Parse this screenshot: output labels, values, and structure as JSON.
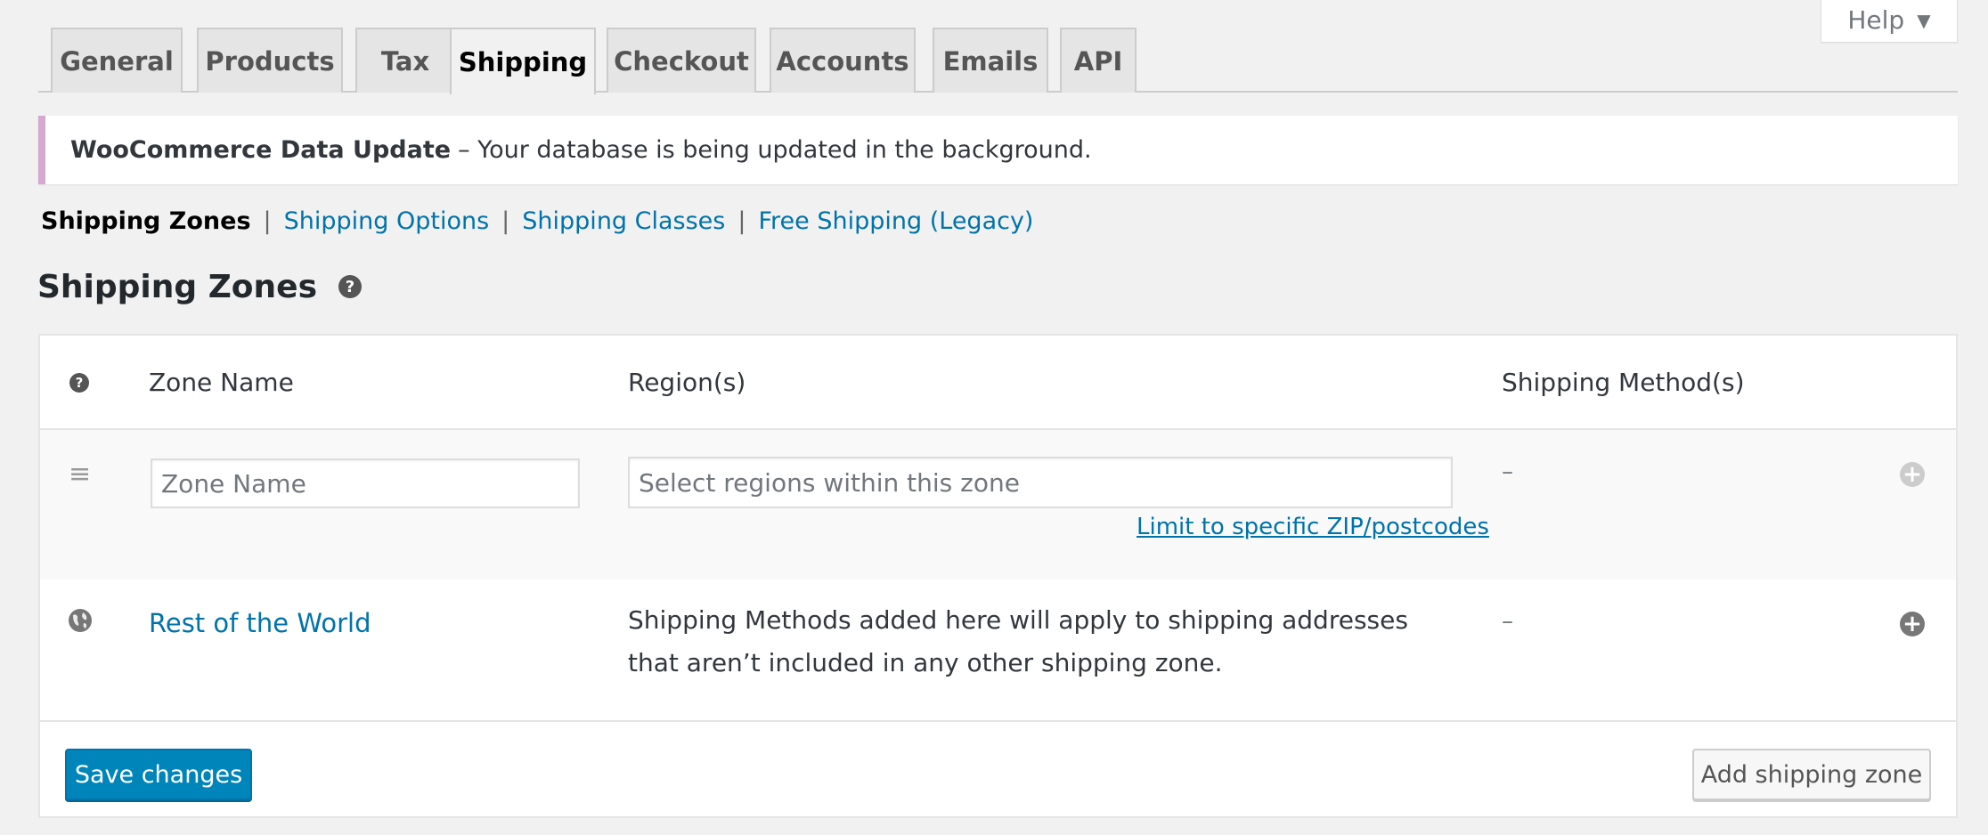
{
  "help": {
    "label": "Help",
    "caret": "▼"
  },
  "tabs": [
    {
      "label": "General"
    },
    {
      "label": "Products"
    },
    {
      "label": "Tax"
    },
    {
      "label": "Shipping",
      "active": true
    },
    {
      "label": "Checkout"
    },
    {
      "label": "Accounts"
    },
    {
      "label": "Emails"
    },
    {
      "label": "API"
    }
  ],
  "notice": {
    "title": "WooCommerce Data Update",
    "message": "– Your database is being updated in the background."
  },
  "subnav": {
    "current": "Shipping Zones",
    "links": [
      "Shipping Options",
      "Shipping Classes",
      "Free Shipping (Legacy)"
    ],
    "separator": "|"
  },
  "page": {
    "title": "Shipping Zones",
    "help_icon": "?"
  },
  "table": {
    "headers": {
      "help_icon": "?",
      "zone_name": "Zone Name",
      "regions": "Region(s)",
      "methods": "Shipping Method(s)"
    },
    "new_row": {
      "zone_placeholder": "Zone Name",
      "regions_placeholder": "Select regions within this zone",
      "limit_link": "Limit to specific ZIP/postcodes",
      "methods": "–"
    },
    "world_row": {
      "name": "Rest of the World",
      "description": "Shipping Methods added here will apply to shipping addresses that aren’t included in any other shipping zone.",
      "methods": "–"
    }
  },
  "buttons": {
    "save": "Save changes",
    "add_zone": "Add shipping zone"
  },
  "colors": {
    "link": "#0073aa",
    "primary_button": "#0085ba",
    "notice_border": "#d5a7d1",
    "plus_disabled": "#ccc",
    "plus_enabled": "#777"
  },
  "icons": {
    "drag_handle": "≡",
    "plus": "+"
  }
}
